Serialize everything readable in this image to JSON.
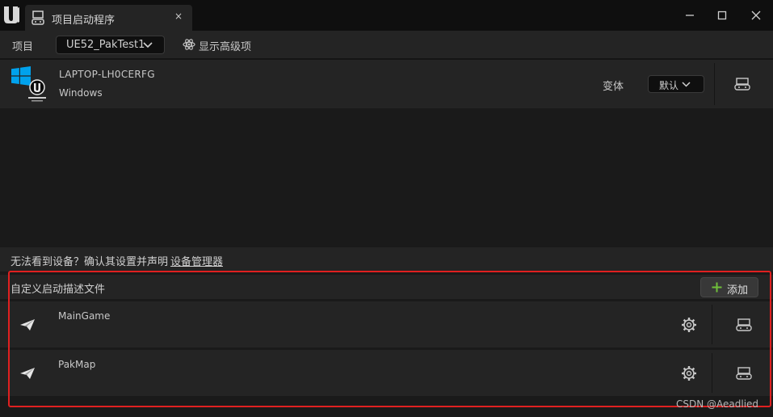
{
  "window": {
    "tab_title": "项目启动程序",
    "close_tab_glyph": "×",
    "icons": {
      "app": "unreal-logo-icon",
      "tab": "project-launcher-icon"
    }
  },
  "toolbar": {
    "project_label": "项目",
    "project_value": "UE52_PakTest1",
    "advanced_label": "显示高级项"
  },
  "device": {
    "name": "LAPTOP-LH0CERFG",
    "platform": "Windows",
    "variant_label": "变体",
    "variant_value": "默认",
    "colors": {
      "windows_logo": "#00a2ed"
    }
  },
  "hint": {
    "text": "无法看到设备？确认其设置并声明",
    "link": "设备管理器"
  },
  "profiles": {
    "title": "自定义启动描述文件",
    "add_label": "添加",
    "items": [
      {
        "name": "MainGame"
      },
      {
        "name": "PakMap"
      }
    ]
  },
  "watermark": "CSDN @Aeadlied",
  "colors": {
    "highlight": "#e02020",
    "add_plus": "#6fbf3a"
  }
}
